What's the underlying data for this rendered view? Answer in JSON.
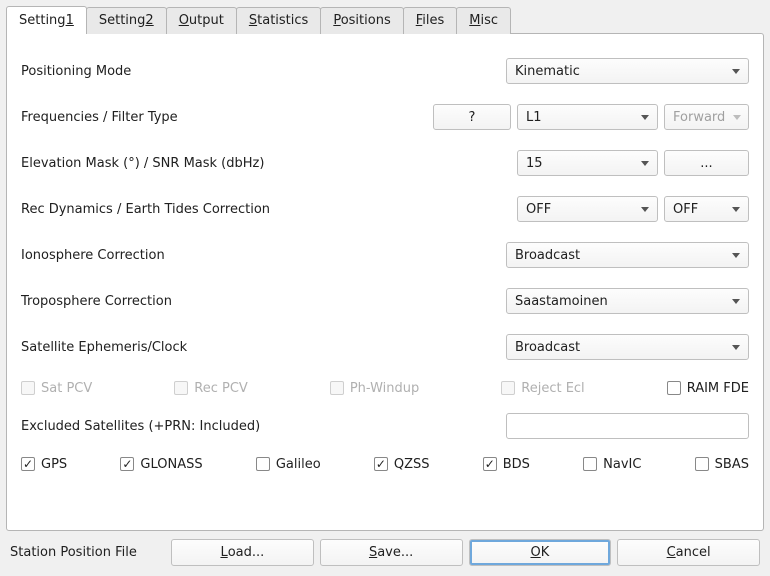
{
  "tabs": {
    "t1_pre": "Setting",
    "t1_mn": "1",
    "t2_pre": "Setting",
    "t2_mn": "2",
    "t3_mn": "O",
    "t3_post": "utput",
    "t4_mn": "S",
    "t4_post": "tatistics",
    "t5_mn": "P",
    "t5_post": "ositions",
    "t6_mn": "F",
    "t6_post": "iles",
    "t7_mn": "M",
    "t7_post": "isc"
  },
  "rows": {
    "positioning_mode": {
      "label": "Positioning Mode",
      "value": "Kinematic"
    },
    "freq_filter": {
      "label": "Frequencies / Filter Type",
      "help": "?",
      "freq": "L1",
      "filter": "Forward"
    },
    "elev_snr": {
      "label": "Elevation Mask (°) / SNR Mask (dbHz)",
      "elev": "15",
      "snr_btn": "..."
    },
    "recdyn_earth": {
      "label": "Rec Dynamics / Earth Tides Correction",
      "rec": "OFF",
      "earth": "OFF"
    },
    "iono": {
      "label": "Ionosphere Correction",
      "value": "Broadcast"
    },
    "tropo": {
      "label": "Troposphere Correction",
      "value": "Saastamoinen"
    },
    "ephem": {
      "label": "Satellite Ephemeris/Clock",
      "value": "Broadcast"
    }
  },
  "flags": {
    "sat_pcv": "Sat PCV",
    "rec_pcv": "Rec PCV",
    "ph_windup": "Ph-Windup",
    "reject_ecl": "Reject Ecl",
    "raim_fde": "RAIM FDE"
  },
  "excluded": {
    "label": "Excluded Satellites (+PRN: Included)",
    "value": ""
  },
  "nav": {
    "gps": "GPS",
    "glonass": "GLONASS",
    "galileo": "Galileo",
    "qzss": "QZSS",
    "bds": "BDS",
    "navic": "NavIC",
    "sbas": "SBAS"
  },
  "footer": {
    "label": "Station Position File",
    "load_mn": "L",
    "load_post": "oad...",
    "save_mn": "S",
    "save_post": "ave...",
    "ok_mn": "O",
    "ok_post": "K",
    "cancel_pre": "",
    "cancel_mn": "C",
    "cancel_post": "ancel"
  }
}
